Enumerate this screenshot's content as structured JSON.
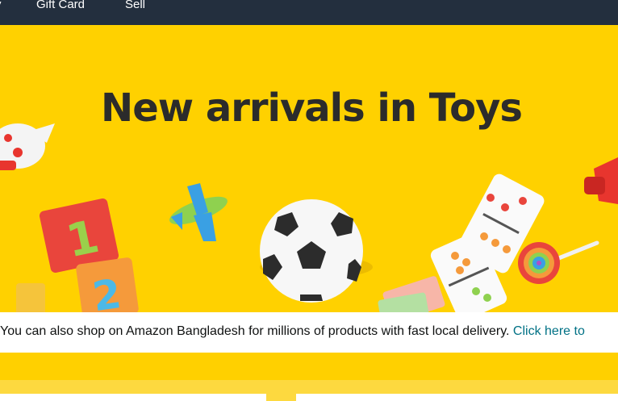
{
  "nav": {
    "partial_item": "y",
    "gift_card": "Gift Card",
    "sell": "Sell"
  },
  "hero": {
    "title": "New arrivals in Toys",
    "background_color": "#ffd100"
  },
  "info": {
    "message": "You can also shop on Amazon Bangladesh for millions of products with fast local delivery.",
    "link": "Click here to"
  },
  "colors": {
    "nav_bg": "#232f3e",
    "link": "#007185",
    "accent_yellow": "#ffd100"
  }
}
